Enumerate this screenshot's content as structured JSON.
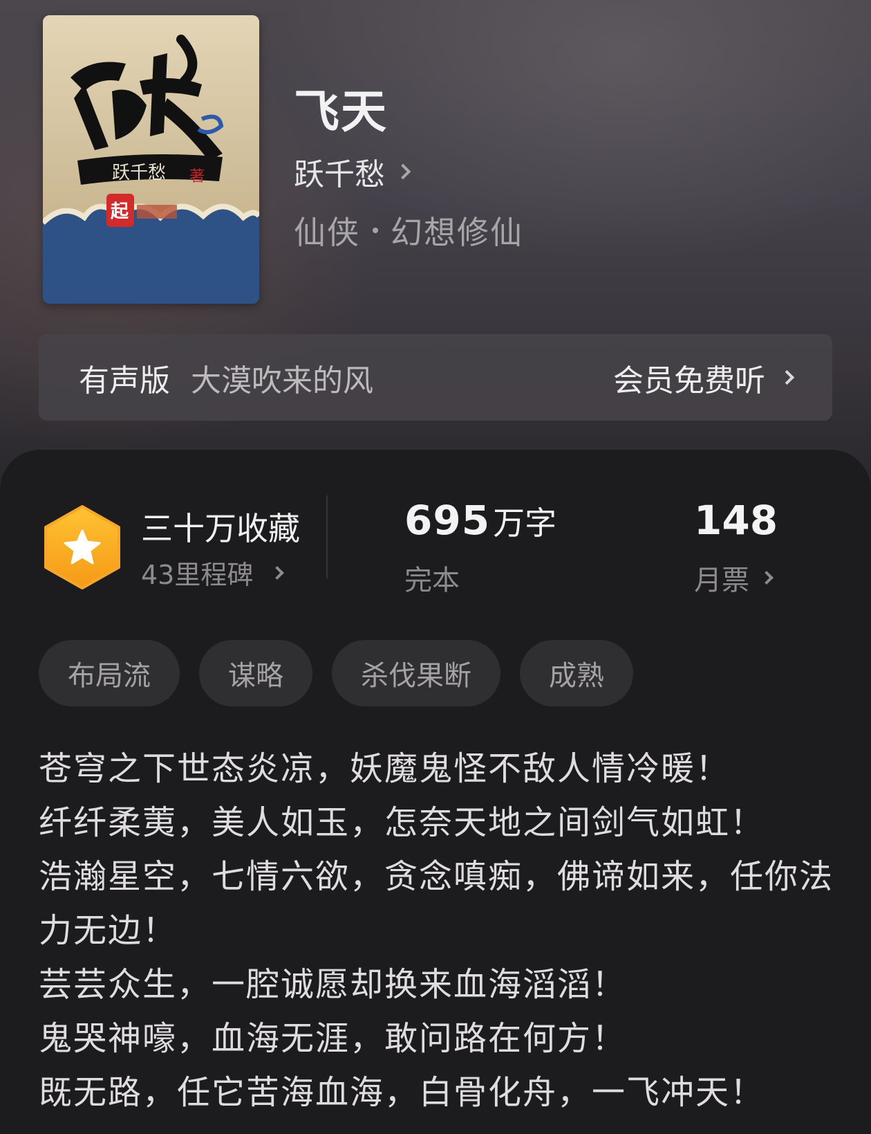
{
  "book": {
    "title": "飞天",
    "author": "跃千愁",
    "genre_main": "仙侠",
    "genre_sub": "幻想修仙",
    "cover_text": "飞天",
    "cover_author": "跃千愁著",
    "cover_icon": "book-cover-image"
  },
  "audio": {
    "label": "有声版",
    "narrator": "大漠吹来的风",
    "cta": "会员免费听"
  },
  "stats": {
    "collections": "三十万收藏",
    "milestones": "43里程碑",
    "word_count": "695",
    "word_unit": "万字",
    "status": "完本",
    "monthly_votes": "148",
    "votes_label": "月票"
  },
  "tags": [
    "布局流",
    "谋略",
    "杀伐果断",
    "成熟"
  ],
  "synopsis": [
    "苍穹之下世态炎凉，妖魔鬼怪不敌人情冷暖！",
    "纤纤柔荑，美人如玉，怎奈天地之间剑气如虹！",
    "浩瀚星空，七情六欲，贪念嗔痴，佛谛如来，任你法力无边！",
    "芸芸众生，一腔诚愿却换来血海滔滔！",
    "鬼哭神嚎，血海无涯，敢问路在何方！",
    "既无路，任它苦海血海，白骨化舟，一飞冲天！"
  ],
  "colors": {
    "badge": "#f7a823",
    "card_bg": "#1c1c1e",
    "tag_bg": "#2f2e31"
  }
}
